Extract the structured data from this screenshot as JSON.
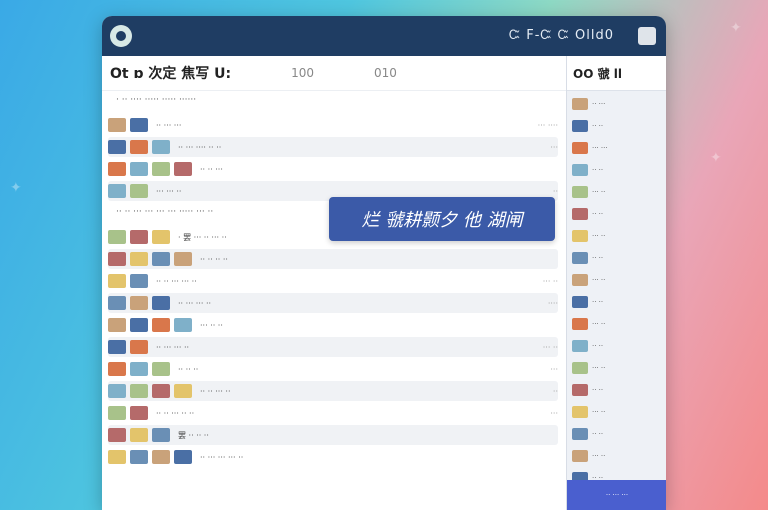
{
  "window": {
    "title_text": "Ꮸ F-Ꮸ Ꮸ Olld0",
    "accent": "#1f3d63"
  },
  "main": {
    "title": "Ot ɒ 次定 焦写 U:",
    "header_num_1": "100",
    "header_num_2": "010",
    "section_1": "· ·· ···· ····· ····· ······",
    "section_2": "·· ·· ··· ··· ··· ··· ····· ··· ··",
    "banner_text": "烂 虢耕颢夕 他 湖闸",
    "rows": [
      {
        "text": "·· ··· ···",
        "meta": "··· ····"
      },
      {
        "text": "·· ··· ···· ·· ··",
        "meta": "···"
      },
      {
        "text": "·· ·· ···",
        "meta": ""
      },
      {
        "text": "··· ··· ··",
        "meta": "··"
      },
      {
        "text": "· 罢 ··· ·· ··· ··",
        "meta": ""
      },
      {
        "text": "·· ·· ·· ··",
        "meta": ""
      },
      {
        "text": "·· ·· ··· ··· ··",
        "meta": "··· ··"
      },
      {
        "text": "·· ··· ··· ··",
        "meta": "····"
      },
      {
        "text": "··· ·· ··",
        "meta": ""
      },
      {
        "text": "·· ··· ··· ··",
        "meta": "··· ··"
      },
      {
        "text": "·· ·· ··",
        "meta": "···"
      },
      {
        "text": "·· ·· ··· ··",
        "meta": "··"
      },
      {
        "text": "·· ·· ··· ·· ··",
        "meta": "···"
      },
      {
        "text": "罢 ·· ·· ··",
        "meta": ""
      },
      {
        "text": "·· ··· ··· ··· ··",
        "meta": ""
      }
    ]
  },
  "sidebar": {
    "title": "OO 虢 ll",
    "items": [
      "·· ···",
      "·· ··",
      "··· ···",
      "·· ··",
      "··· ··",
      "·· ··",
      "··· ··",
      "·· ··",
      "··· ··",
      "·· ··",
      "··· ··",
      "·· ··",
      "··· ··",
      "·· ··",
      "··· ··",
      "·· ··",
      "··· ··",
      "·· ··",
      "··· ··",
      "·· ··"
    ],
    "footer": "·· ··· ···"
  }
}
